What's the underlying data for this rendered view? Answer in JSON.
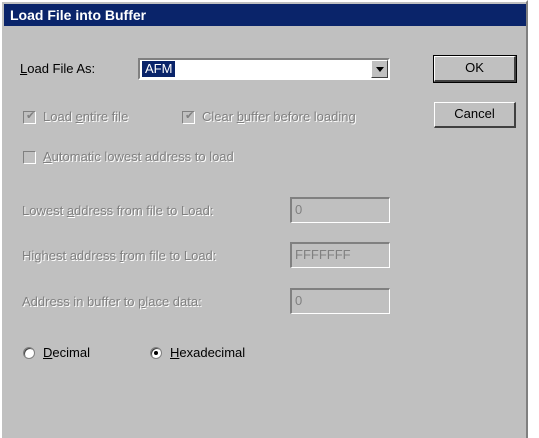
{
  "window": {
    "title": "Load File into Buffer"
  },
  "load_file_as": {
    "label": "Load File As:",
    "selected": "AFM"
  },
  "buttons": {
    "ok": "OK",
    "cancel": "Cancel"
  },
  "options": {
    "load_entire_file": {
      "label": "Load entire file",
      "checked": true,
      "enabled": false
    },
    "clear_buffer": {
      "label": "Clear buffer before loading",
      "checked": true,
      "enabled": false
    },
    "auto_lowest": {
      "label": "Automatic lowest address to load",
      "checked": false,
      "enabled": false
    }
  },
  "addresses": {
    "lowest": {
      "label": "Lowest address from file to Load:",
      "value": "0"
    },
    "highest": {
      "label": "Highest address from file to Load:",
      "value": "FFFFFFF"
    },
    "place": {
      "label": "Address in buffer to place data:",
      "value": "0"
    }
  },
  "radix": {
    "decimal": {
      "label": "Decimal",
      "selected": false
    },
    "hexadecimal": {
      "label": "Hexadecimal",
      "selected": true
    }
  },
  "colors": {
    "titlebar": "#0a246a",
    "face": "#c0c0c0",
    "disabled_text": "#808080"
  }
}
